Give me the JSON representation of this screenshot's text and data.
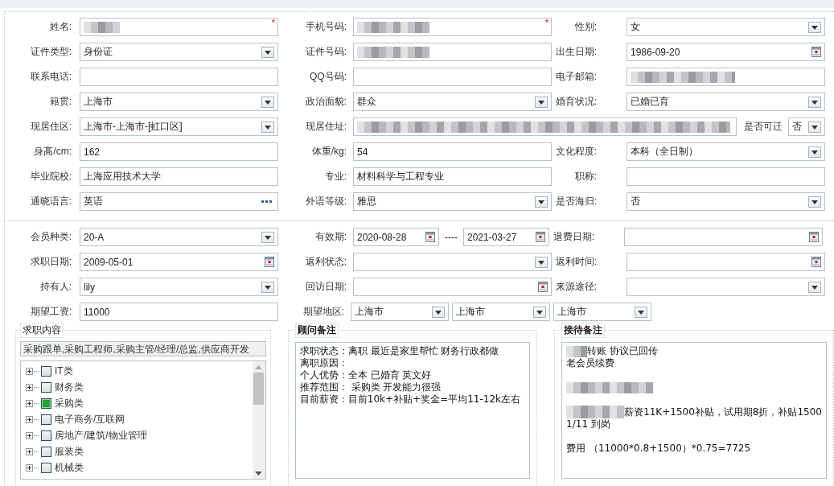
{
  "sections": [
    {
      "rows": [
        {
          "cells": [
            {
              "kind": "field",
              "label": "姓名:",
              "controls": [
                {
                  "kind": "text",
                  "redacted": true,
                  "mark": "*"
                }
              ]
            },
            {
              "kind": "field",
              "label": "手机号码:",
              "controls": [
                {
                  "kind": "text",
                  "redacted": true,
                  "mark": "*"
                }
              ]
            },
            {
              "kind": "field",
              "label": "性别:",
              "controls": [
                {
                  "kind": "select",
                  "value": "女"
                }
              ]
            }
          ]
        },
        {
          "cells": [
            {
              "kind": "field",
              "label": "证件类型:",
              "controls": [
                {
                  "kind": "select",
                  "value": "身份证"
                }
              ]
            },
            {
              "kind": "field",
              "label": "证件号码:",
              "controls": [
                {
                  "kind": "text",
                  "redacted": true
                }
              ]
            },
            {
              "kind": "field",
              "label": "出生日期:",
              "controls": [
                {
                  "kind": "date",
                  "value": "1986-09-20"
                }
              ]
            }
          ]
        },
        {
          "cells": [
            {
              "kind": "field",
              "label": "联系电话:",
              "controls": [
                {
                  "kind": "text"
                }
              ]
            },
            {
              "kind": "field",
              "label": "QQ号码:",
              "controls": [
                {
                  "kind": "text"
                }
              ]
            },
            {
              "kind": "field",
              "label": "电子邮箱:",
              "controls": [
                {
                  "kind": "text",
                  "redacted": true
                }
              ]
            }
          ]
        },
        {
          "cells": [
            {
              "kind": "field",
              "label": "籍贯:",
              "controls": [
                {
                  "kind": "select",
                  "value": "上海市"
                }
              ]
            },
            {
              "kind": "field",
              "label": "政治面貌:",
              "controls": [
                {
                  "kind": "select",
                  "value": "群众"
                }
              ]
            },
            {
              "kind": "field",
              "label": "婚育状况:",
              "controls": [
                {
                  "kind": "select",
                  "value": "已婚已育"
                }
              ]
            }
          ]
        },
        {
          "cells": [
            {
              "kind": "field",
              "label": "现居住区:",
              "controls": [
                {
                  "kind": "select",
                  "value": "上海市-上海市-[虹口区]"
                }
              ]
            },
            {
              "kind": "wide",
              "label": "现居住址:",
              "controls": [
                {
                  "kind": "text",
                  "redacted": true
                }
              ]
            },
            {
              "kind": "compact",
              "label": "是否可迁",
              "controls": [
                {
                  "kind": "select",
                  "value": "否"
                }
              ]
            }
          ]
        },
        {
          "cells": [
            {
              "kind": "field",
              "label": "身高/cm:",
              "controls": [
                {
                  "kind": "text",
                  "value": "162"
                }
              ]
            },
            {
              "kind": "field",
              "label": "体重/kg:",
              "controls": [
                {
                  "kind": "text",
                  "value": "54"
                }
              ]
            },
            {
              "kind": "field",
              "label": "文化程度:",
              "controls": [
                {
                  "kind": "select",
                  "value": "本科（全日制）"
                }
              ]
            }
          ]
        },
        {
          "cells": [
            {
              "kind": "field",
              "label": "毕业院校:",
              "controls": [
                {
                  "kind": "text",
                  "value": "上海应用技术大学"
                }
              ]
            },
            {
              "kind": "field",
              "label": "专业:",
              "controls": [
                {
                  "kind": "text",
                  "value": "材料科学与工程专业"
                }
              ]
            },
            {
              "kind": "field",
              "label": "职称:",
              "controls": [
                {
                  "kind": "text"
                }
              ]
            }
          ]
        },
        {
          "cells": [
            {
              "kind": "field",
              "label": "通晓语言:",
              "controls": [
                {
                  "kind": "lookup",
                  "value": "英语"
                }
              ]
            },
            {
              "kind": "field",
              "label": "外语等级:",
              "controls": [
                {
                  "kind": "select",
                  "value": "雅思"
                }
              ]
            },
            {
              "kind": "field",
              "label": "是否海归:",
              "controls": [
                {
                  "kind": "select",
                  "value": "否"
                }
              ]
            }
          ]
        }
      ]
    },
    {
      "rows": [
        {
          "cells": [
            {
              "kind": "field",
              "label": "会员种类:",
              "controls": [
                {
                  "kind": "select",
                  "value": "20-A"
                }
              ]
            },
            {
              "kind": "range",
              "label": "有效期:",
              "separator": "----",
              "controls": [
                {
                  "kind": "date",
                  "value": "2020-08-28"
                },
                {
                  "kind": "date",
                  "value": "2021-03-27"
                }
              ]
            },
            {
              "kind": "field",
              "label": "退费日期:",
              "controls": [
                {
                  "kind": "date"
                }
              ]
            }
          ]
        },
        {
          "cells": [
            {
              "kind": "field",
              "label": "求职日期:",
              "controls": [
                {
                  "kind": "date",
                  "value": "2009-05-01"
                }
              ]
            },
            {
              "kind": "field",
              "label": "返利状态:",
              "controls": [
                {
                  "kind": "select"
                }
              ]
            },
            {
              "kind": "field",
              "label": "返利时间:",
              "controls": [
                {
                  "kind": "date"
                }
              ]
            }
          ]
        },
        {
          "cells": [
            {
              "kind": "field",
              "label": "持有人:",
              "controls": [
                {
                  "kind": "select",
                  "value": "lily"
                }
              ]
            },
            {
              "kind": "field",
              "label": "回访日期:",
              "controls": [
                {
                  "kind": "date"
                }
              ]
            },
            {
              "kind": "field",
              "label": "来源途径:",
              "controls": [
                {
                  "kind": "select"
                }
              ]
            }
          ]
        },
        {
          "cells": [
            {
              "kind": "field",
              "label": "期望工资:",
              "controls": [
                {
                  "kind": "text",
                  "value": "11000"
                }
              ]
            },
            {
              "kind": "region",
              "label": "期望地区:",
              "controls": [
                {
                  "kind": "select",
                  "value": "上海市"
                },
                {
                  "kind": "select",
                  "value": "上海市"
                },
                {
                  "kind": "select",
                  "value": "上海市"
                }
              ]
            }
          ]
        }
      ]
    }
  ],
  "job_content": {
    "legend": "求职内容",
    "emphasis": false,
    "summary": "采购跟单,采购工程师,采购主管/经理/总监,供应商开发",
    "tree": [
      {
        "label": "IT类",
        "expanded": false,
        "checked": false
      },
      {
        "label": "财务类",
        "expanded": false,
        "checked": false
      },
      {
        "label": "采购类",
        "expanded": false,
        "checked": true
      },
      {
        "label": "电子商务/互联网",
        "expanded": false,
        "checked": false
      },
      {
        "label": "房地产/建筑/物业管理",
        "expanded": false,
        "checked": false
      },
      {
        "label": "服装类",
        "expanded": false,
        "checked": false
      },
      {
        "label": "机械类",
        "expanded": false,
        "checked": false
      }
    ]
  },
  "notes": [
    {
      "legend": "顾问备注",
      "emphasis": true,
      "paragraphs": [
        {
          "lines": [
            {
              "text": "求职状态：离职 最近是家里帮忙 财务行政都做"
            },
            {
              "text": "离职原因："
            },
            {
              "text": "个人优势：全本 已婚育 英文好"
            },
            {
              "text": "推荐范围： 采购类 开发能力很强"
            },
            {
              "text": "目前薪资：目前10k+补贴+奖金=平均11-12k左右"
            }
          ]
        }
      ]
    },
    {
      "legend": "接待备注",
      "emphasis": true,
      "paragraphs": [
        {
          "lines": [
            {
              "text": " 转账 协议已回传",
              "redacted": true
            },
            {
              "text": "老会员续费"
            }
          ]
        },
        {
          "lines": [
            {
              "redacted": true
            }
          ]
        },
        {
          "lines": [
            {
              "text": "薪资11K+1500补贴，试用期8折，补贴1500",
              "redacted": true
            },
            {
              "text": "1/11 到岗"
            }
          ]
        },
        {
          "lines": [
            {
              "text": "费用 （11000*0.8+1500）*0.75=7725"
            }
          ]
        }
      ]
    }
  ]
}
